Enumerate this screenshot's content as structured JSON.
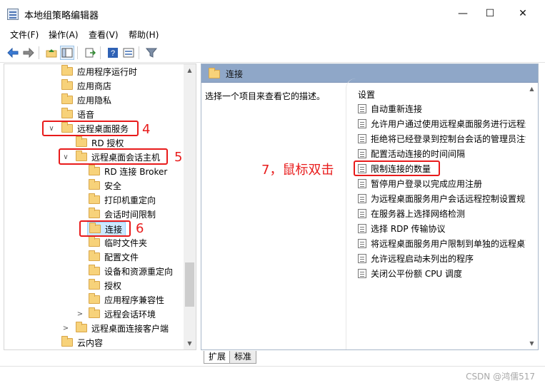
{
  "window": {
    "title": "本地组策略编辑器",
    "minimize": "—",
    "maximize": "☐",
    "close": "✕"
  },
  "menu": [
    "文件(F)",
    "操作(A)",
    "查看(V)",
    "帮助(H)"
  ],
  "toolbar_icons": [
    "back-icon",
    "forward-icon",
    "up-folder-icon",
    "show-hide-tree-icon",
    "export-list-icon",
    "help-icon",
    "properties-icon",
    "filter-icon"
  ],
  "tree": [
    {
      "label": "应用程序运行时",
      "expander": ""
    },
    {
      "label": "应用商店",
      "expander": ""
    },
    {
      "label": "应用隐私",
      "expander": ""
    },
    {
      "label": "语音",
      "expander": ""
    },
    {
      "label": "远程桌面服务",
      "expander": "∨"
    },
    {
      "label": "RD 授权",
      "expander": ""
    },
    {
      "label": "远程桌面会话主机",
      "expander": "∨"
    },
    {
      "label": "RD 连接 Broker",
      "expander": ""
    },
    {
      "label": "安全",
      "expander": ""
    },
    {
      "label": "打印机重定向",
      "expander": ""
    },
    {
      "label": "会话时间限制",
      "expander": ""
    },
    {
      "label": "连接",
      "expander": ""
    },
    {
      "label": "临时文件夹",
      "expander": ""
    },
    {
      "label": "配置文件",
      "expander": ""
    },
    {
      "label": "设备和资源重定向",
      "expander": ""
    },
    {
      "label": "授权",
      "expander": ""
    },
    {
      "label": "应用程序兼容性",
      "expander": ""
    },
    {
      "label": "远程会话环境",
      "expander": ">"
    },
    {
      "label": "远程桌面连接客户端",
      "expander": ">"
    },
    {
      "label": "云内容",
      "expander": ""
    }
  ],
  "content": {
    "header_title": "连接",
    "description": "选择一个项目来查看它的描述。",
    "settings_header": "设置",
    "settings": [
      "自动重新连接",
      "允许用户通过使用远程桌面服务进行远程连接",
      "拒绝将已经登录到控制台会话的管理员注销",
      "配置活动连接的时间间隔",
      "限制连接的数量",
      "暂停用户登录以完成应用注册",
      "为远程桌面服务用户会话远程控制设置规则",
      "在服务器上选择网络检测",
      "选择 RDP 传输协议",
      "将远程桌面服务用户限制到单独的远程桌面服",
      "允许远程启动未列出的程序",
      "关闭公平份额 CPU 调度"
    ]
  },
  "tabs": [
    "扩展",
    "标准"
  ],
  "annotations": {
    "a4": "4",
    "a5": "5",
    "a6": "6",
    "a7": "7，鼠标双击"
  },
  "watermark": "CSDN @鸿儒517",
  "colors": {
    "annotation_red": "#e81b1b",
    "header_blue": "#8fa7c8",
    "selection": "#cce8ff"
  }
}
